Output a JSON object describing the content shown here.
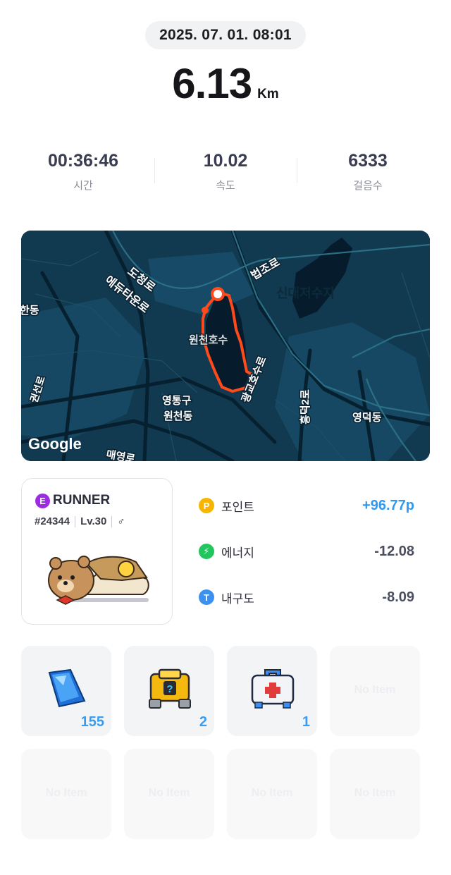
{
  "header": {
    "datetime": "2025. 07. 01. 08:01",
    "distance_value": "6.13",
    "distance_unit": "Km"
  },
  "stats": [
    {
      "value": "00:36:46",
      "label": "시간"
    },
    {
      "value": "10.02",
      "label": "속도"
    },
    {
      "value": "6333",
      "label": "걸음수"
    }
  ],
  "map": {
    "labels": {
      "dochung": "도청로",
      "edutain": "에듀타운로",
      "beopjo": "법조로",
      "handong": "한동",
      "wancheon_lake": "원천호수",
      "gwanggyo_hosu": "광교호수로",
      "gwonseon": "권선로",
      "yeongtong": "영통구",
      "wonchen": "원천동",
      "heungdeok": "흥덕2로",
      "yeongdeok": "영덕동",
      "maeyeong": "매영로",
      "sin": "신대저수지",
      "google": "Google"
    },
    "colors": {
      "water": "#061c2c",
      "land": "#11394f",
      "route": "#ff4a1c"
    }
  },
  "runner": {
    "badge": "E",
    "title": "RUNNER",
    "id": "#24344",
    "level": "Lv.30",
    "gender_symbol": "♂"
  },
  "resources": [
    {
      "icon": "P",
      "icon_name": "point-icon",
      "color": "#f7b500",
      "label": "포인트",
      "value": "+96.77p"
    },
    {
      "icon": "⚡",
      "icon_name": "energy-icon",
      "color": "#22c55e",
      "label": "에너지",
      "value": "-12.08"
    },
    {
      "icon": "T",
      "icon_name": "durability-icon",
      "color": "#3d8ff0",
      "label": "내구도",
      "value": "-8.09"
    }
  ],
  "items": [
    {
      "type": "gem",
      "count": "155"
    },
    {
      "type": "mystery-box",
      "count": "2"
    },
    {
      "type": "first-aid-kit",
      "count": "1"
    },
    {
      "type": "empty",
      "empty_label": "No Item"
    },
    {
      "type": "empty",
      "empty_label": "No Item"
    },
    {
      "type": "empty",
      "empty_label": "No Item"
    },
    {
      "type": "empty",
      "empty_label": "No Item"
    },
    {
      "type": "empty",
      "empty_label": "No Item"
    }
  ]
}
